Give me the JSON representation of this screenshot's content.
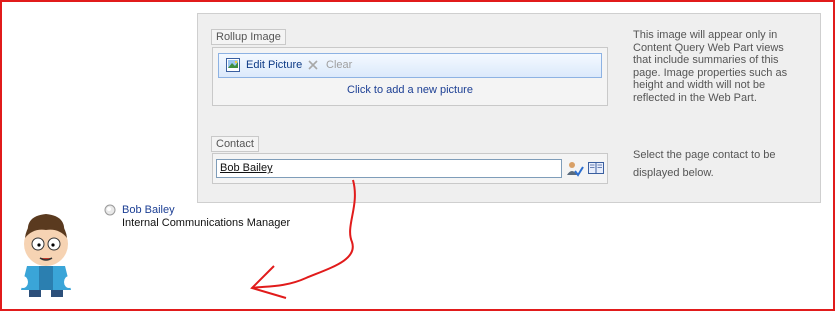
{
  "rollup": {
    "legend": "Rollup Image",
    "edit_label": "Edit Picture",
    "clear_label": "Clear",
    "add_link": "Click to add a new picture",
    "description": "This image will appear only in Content Query Web Part views that include summaries of this page. Image properties such as height and width will not be reflected in the Web Part."
  },
  "contact": {
    "legend": "Contact",
    "value": "Bob Bailey",
    "description": "Select the page contact to be displayed below."
  },
  "person": {
    "name": "Bob Bailey",
    "title": "Internal Communications Manager"
  },
  "icons": {
    "picture": "picture-icon",
    "clear": "x-icon",
    "check_names": "check-names-icon",
    "browse": "address-book-icon",
    "presence": "presence-icon"
  },
  "colors": {
    "frame": "#e11b1b",
    "link": "#1c3f94",
    "toolbar_border": "#8db2e3",
    "panel": "#efefef"
  }
}
